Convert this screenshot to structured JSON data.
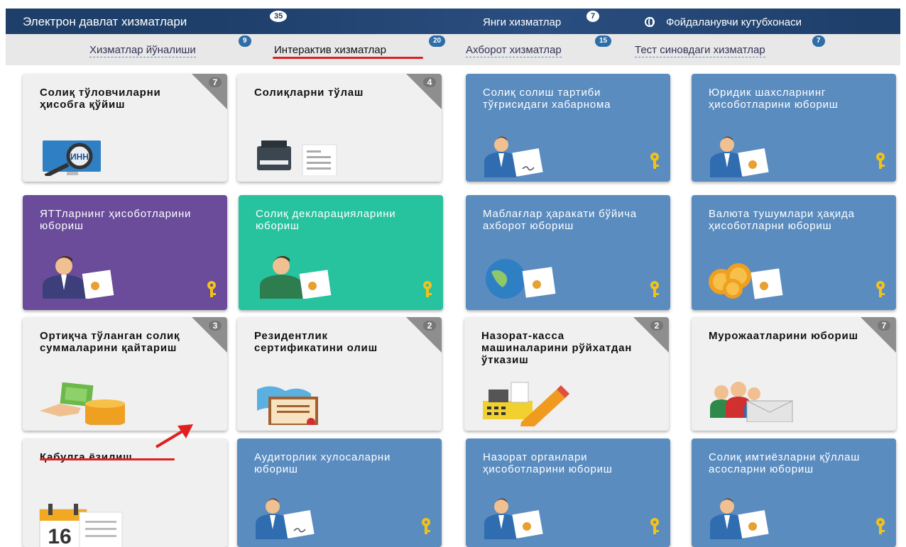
{
  "header": {
    "title": "Электрон давлат хизматлари",
    "title_badge": "35",
    "new_services": "Янги хизматлар",
    "new_badge": "7",
    "library": "Фойдаланувчи кутубхонаси"
  },
  "subnav": {
    "tabs": [
      {
        "label": "Хизматлар йўналиши",
        "badge": "9"
      },
      {
        "label": "Интерактив хизматлар",
        "badge": "20"
      },
      {
        "label": "Ахборот хизматлар",
        "badge": "15"
      },
      {
        "label": "Тест синовдаги хизматлар",
        "badge": "7"
      }
    ]
  },
  "tiles": [
    {
      "title": "Солиқ тўловчиларни ҳисобга қўйиш",
      "count": "7"
    },
    {
      "title": "Солиқларни тўлаш",
      "count": "4"
    },
    {
      "title": "Солиқ солиш тартиби тўғрисидаги хабарнома"
    },
    {
      "title": "Юридик шахсларнинг ҳисоботларини юбориш"
    },
    {
      "title": "ЯТТларнинг ҳисоботларини юбориш"
    },
    {
      "title": "Солиқ декларацияларини юбориш"
    },
    {
      "title": "Маблағлар ҳаракати бўйича ахборот юбориш"
    },
    {
      "title": "Валюта тушумлари ҳақида ҳисоботларни юбориш"
    },
    {
      "title": "Ортиқча тўланган солиқ суммаларини қайтариш",
      "count": "3"
    },
    {
      "title": "Резидентлик сертификатини олиш",
      "count": "2"
    },
    {
      "title": "Назорат-касса машиналарини рўйхатдан ўтказиш",
      "count": "2"
    },
    {
      "title": "Мурожаатларини юбориш",
      "count": "7"
    },
    {
      "title": "Қабулга ёзилиш"
    },
    {
      "title": "Аудиторлик хулосаларни юбориш"
    },
    {
      "title": "Назорат органлари ҳисоботларини юбориш"
    },
    {
      "title": "Солиқ имтиёзларни қўллаш асосларни юбориш"
    }
  ],
  "icons": {
    "inn_label": "ИНН",
    "calendar_label": "16"
  },
  "colors": {
    "header": "#1e3f6a",
    "blue_tile": "#5a8cc0",
    "purple_tile": "#6a4c9b",
    "teal_tile": "#27c29e",
    "gray_tile": "#f0f0f0",
    "highlight": "#e02020"
  }
}
